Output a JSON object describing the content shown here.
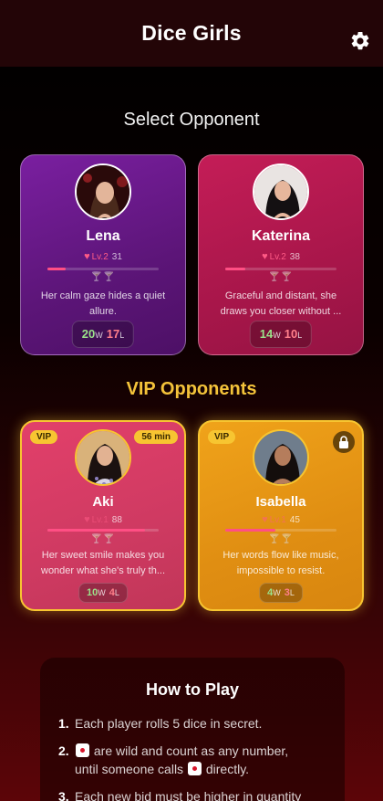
{
  "app": {
    "title": "Dice Girls"
  },
  "sections": {
    "select_title": "Select Opponent",
    "vip_title": "VIP Opponents"
  },
  "opponents": [
    {
      "name": "Lena",
      "level": "Lv.2",
      "points": "31",
      "progress": 0.16,
      "description": "Her calm gaze hides a quiet allure.",
      "wins": "20",
      "losses": "17",
      "w": "W",
      "l": "L"
    },
    {
      "name": "Katerina",
      "level": "Lv.2",
      "points": "38",
      "progress": 0.18,
      "description": "Graceful and distant, she draws you closer without ...",
      "wins": "14",
      "losses": "10",
      "w": "W",
      "l": "L"
    }
  ],
  "vip_opponents": [
    {
      "badge": "VIP",
      "timer": "56 min",
      "name": "Aki",
      "level": "Lv.1",
      "points": "88",
      "progress": 0.88,
      "description": "Her sweet smile makes you wonder what she's truly th...",
      "wins": "10",
      "losses": "4",
      "w": "W",
      "l": "L",
      "locked": false
    },
    {
      "badge": "VIP",
      "name": "Isabella",
      "level": "Lv.1",
      "points": "45",
      "progress": 0.45,
      "description": "Her words flow like music, impossible to resist.",
      "wins": "4",
      "losses": "3",
      "w": "W",
      "l": "L",
      "locked": true
    }
  ],
  "how_to_play": {
    "title": "How to Play",
    "steps": [
      {
        "num": "1.",
        "text": "Each player rolls 5 dice in secret."
      },
      {
        "num": "2.",
        "text_a": "are wild and count as any number,",
        "text_b": "until someone calls",
        "text_c": "directly."
      },
      {
        "num": "3.",
        "text": "Each new bid must be higher in quantity"
      }
    ]
  },
  "icons": {
    "settings": "gear-icon",
    "lock": "lock-icon",
    "heart": "heart-icon",
    "glasses": "cocktail-glass-icon",
    "die": "die-one-icon"
  },
  "colors": {
    "accent_gold": "#f7c531",
    "pink": "#ff5b86",
    "win_green": "#9be28a",
    "loss_red": "#ff7f8a"
  }
}
